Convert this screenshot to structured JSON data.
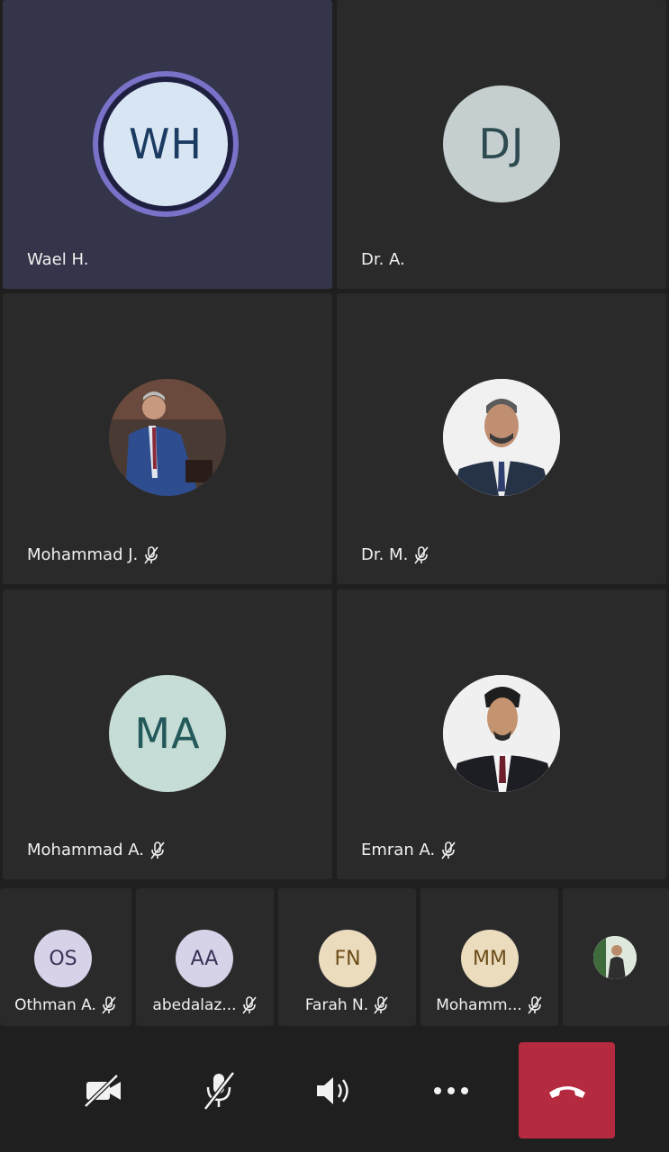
{
  "participants": [
    {
      "name": "Wael H.",
      "initials": "WH",
      "muted": false,
      "avatar_bg": "#d8e6f3",
      "avatar_fg": "#1c3b62",
      "speaking": true
    },
    {
      "name": "Dr. A.",
      "initials": "DJ",
      "muted": false,
      "avatar_bg": "#c5cfcf",
      "avatar_fg": "#2c4a4f"
    },
    {
      "name": "Mohammad J.",
      "initials": "",
      "muted": true,
      "photo": true
    },
    {
      "name": "Dr. M.",
      "initials": "",
      "muted": true,
      "photo": true
    },
    {
      "name": "Mohammad A.",
      "initials": "MA",
      "muted": true,
      "avatar_bg": "#c6dcd6",
      "avatar_fg": "#23595a"
    },
    {
      "name": "Emran A.",
      "initials": "",
      "muted": true,
      "photo": true
    }
  ],
  "strip": [
    {
      "name": "Othman A.",
      "initials": "OS",
      "muted": true,
      "avatar_bg": "#d7d2e8",
      "avatar_fg": "#3a3358"
    },
    {
      "name": "abedalaz...",
      "initials": "AA",
      "muted": true,
      "avatar_bg": "#d6d2e8",
      "avatar_fg": "#3a3358"
    },
    {
      "name": "Farah N.",
      "initials": "FN",
      "muted": true,
      "avatar_bg": "#ecdcbe",
      "avatar_fg": "#6b4c18"
    },
    {
      "name": "Mohamm...",
      "initials": "MM",
      "muted": true,
      "avatar_bg": "#ecdcbe",
      "avatar_fg": "#6b4c18"
    },
    {
      "name": "",
      "initials": "",
      "photo": true
    }
  ],
  "controls": {
    "camera": "camera-off-icon",
    "mic": "mic-off-icon",
    "speaker": "speaker-icon",
    "more": "more-icon",
    "hangup": "hang-up-icon"
  },
  "colors": {
    "background": "#1f1f1f",
    "tile": "#2a2a2a",
    "active_tile": "#34344a",
    "speaking_ring": "#7a72c8",
    "hangup": "#b42a3e"
  }
}
